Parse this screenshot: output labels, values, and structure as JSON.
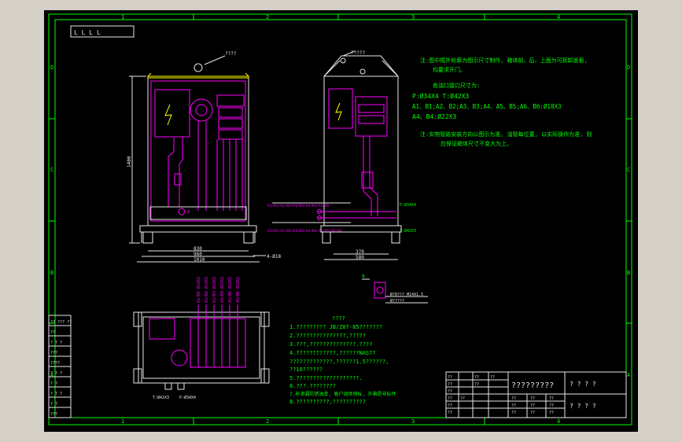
{
  "frame": {
    "col_labels_top": [
      "1",
      "2",
      "3",
      "4"
    ],
    "col_labels_bottom": [
      "1",
      "2",
      "3",
      "4"
    ],
    "row_labels_left": [
      "D",
      "C",
      "B",
      "A"
    ],
    "row_labels_right": [
      "D",
      "C",
      "B",
      "A"
    ]
  },
  "colors": {
    "background": "#000000",
    "frame": "#00ff00",
    "outline": "#e8e8e8",
    "piping": "#ff00ff",
    "accent": "#ffff00",
    "text_cyan": "#00ffff"
  },
  "corner_mark": "L L L L",
  "front_view": {
    "top_callout": "????",
    "height_dim": "1400",
    "width_dims": [
      "830",
      "960",
      "1010"
    ],
    "hole_dim": "4-Ø18",
    "label_p": "P"
  },
  "side_view": {
    "top_callout": "?????",
    "width_dims": [
      "370",
      "580"
    ],
    "upper_port_label": "P:Ø34X4",
    "lower_port_label": "T:Ø42X3",
    "upper_line_note": "A1/B1/A2/B2/A3/B3/A4/B4/A5/B5",
    "lower_line_note": "A1/B1/A2/B2/A3/B3/A4/B4/A5/B5/A6/B6"
  },
  "detail_view": {
    "label": "A",
    "note1": "Ø?0??? M14X1.5",
    "note2": "Ø?????"
  },
  "top_view": {
    "port_labels_vertical": [
      "A1/B1 Ø18X3",
      "A2/B2 Ø18X3",
      "A3/B3 Ø18X3",
      "A4/B4 Ø22X3",
      "A5/B5 Ø18X3",
      "A6/B6 Ø18X3"
    ],
    "bottom_left_label": "T:Ø42X3",
    "bottom_right_label": "P:Ø34X4"
  },
  "notes_right": [
    "注:图中框外轮廓为图示尺寸制作, 箱体前、后、上面为可拆卸盖板,",
    "均要求开门。",
    "各油口接口尺寸为:",
    "P:Ø34X4     T:Ø42X3",
    "A1、B1;A2、B2;A3、B3;A4、A5、B5;A6、B6:Ø18X3",
    "A4、B4:Ø22X3",
    "注:实物管路安装方向以图示为准, 油管每位置, 以实际操作为准, 则",
    "应保证箱体尺寸不变大为上。"
  ],
  "tech_requirements": {
    "title": "????",
    "items": [
      "1.????????? JB/Z07-85???????",
      "2.???????????????,?????",
      "3.???,??????????????.????",
      "4.????????????,??????NAS7?",
      "  ?????????????,??????1.5??????,",
      "  ??10??????",
      "5.???????????????????.",
      "6.???.????????",
      "7.补渗漏防锈油漆, 客户现场销标, 外箱是非标件",
      "8.??????????,??????????"
    ]
  },
  "left_table": {
    "rows": [
      [
        "?? ??? ??"
      ],
      [
        "??"
      ],
      [
        "? ? ?"
      ],
      [
        "???"
      ],
      [
        "????"
      ],
      [
        "? ? ?"
      ],
      [
        "? ?"
      ],
      [
        "? ? ?"
      ],
      [
        "? ?"
      ],
      [
        "???"
      ]
    ]
  },
  "title_block": {
    "title": "?????????",
    "sub_marks": "? ? ? ?",
    "company_marks": "? ? ? ?",
    "row_labels": [
      "??",
      "??",
      "??",
      "??",
      "??",
      "??",
      "??"
    ],
    "cells": [
      "??",
      "??",
      "??",
      "??",
      "??",
      "??",
      "??",
      "??",
      "??",
      "??",
      "??",
      "??"
    ]
  }
}
